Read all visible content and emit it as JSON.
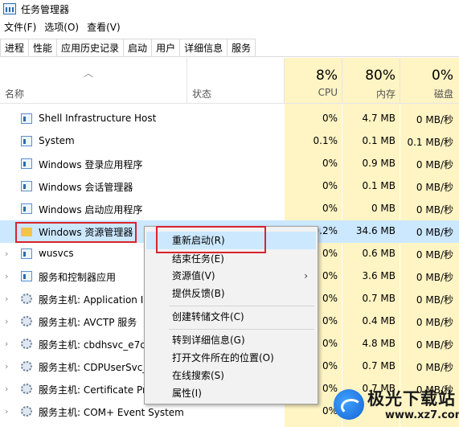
{
  "window": {
    "title": "任务管理器"
  },
  "menu": [
    "文件(F)",
    "选项(O)",
    "查看(V)"
  ],
  "tabs": [
    "进程",
    "性能",
    "应用历史记录",
    "启动",
    "用户",
    "详细信息",
    "服务"
  ],
  "header": {
    "name": "名称",
    "status": "状态",
    "cpu_pct": "8%",
    "cpu": "CPU",
    "mem_pct": "80%",
    "mem": "内存",
    "disk_pct": "0%",
    "disk": "磁盘"
  },
  "rows": [
    {
      "name": "Shell Infrastructure Host",
      "cpu": "0%",
      "mem": "4.7 MB",
      "disk": "0 MB/秒"
    },
    {
      "name": "System",
      "cpu": "0.1%",
      "mem": "0.1 MB",
      "disk": "0.1 MB/秒"
    },
    {
      "name": "Windows 登录应用程序",
      "cpu": "0%",
      "mem": "0.9 MB",
      "disk": "0 MB/秒"
    },
    {
      "name": "Windows 会话管理器",
      "cpu": "0%",
      "mem": "0.1 MB",
      "disk": "0 MB/秒"
    },
    {
      "name": "Windows 启动应用程序",
      "cpu": "0%",
      "mem": "0 MB",
      "disk": "0 MB/秒"
    },
    {
      "name": "Windows 资源管理器",
      "cpu": "0.2%",
      "mem": "34.6 MB",
      "disk": "0 MB/秒"
    },
    {
      "name": "wusvcs",
      "cpu": "0%",
      "mem": "0.6 MB",
      "disk": "0 MB/秒"
    },
    {
      "name": "服务和控制器应用",
      "cpu": "0%",
      "mem": "3.6 MB",
      "disk": "0 MB/秒"
    },
    {
      "name": "服务主机: Application In",
      "cpu": "0%",
      "mem": "0.7 MB",
      "disk": "0 MB/秒"
    },
    {
      "name": "服务主机: AVCTP 服务",
      "cpu": "0%",
      "mem": "0.4 MB",
      "disk": "0 MB/秒"
    },
    {
      "name": "服务主机: cbdhsvc_e7c3",
      "cpu": "0%",
      "mem": "4.8 MB",
      "disk": "0 MB/秒"
    },
    {
      "name": "服务主机: CDPUserSvc_",
      "cpu": "0%",
      "mem": "0.7 MB",
      "disk": "0 MB/秒"
    },
    {
      "name": "服务主机: Certificate Pr",
      "cpu": "0%",
      "mem": "0.7 MB",
      "disk": "0 MB/秒"
    },
    {
      "name": "服务主机: COM+ Event System",
      "cpu": "0%",
      "mem": "",
      "disk": ""
    }
  ],
  "context_menu": {
    "restart": "重新启动(R)",
    "end_task": "结束任务(E)",
    "resource_values": "资源值(V)",
    "feedback": "提供反馈(B)",
    "dump": "创建转储文件(C)",
    "details": "转到详细信息(G)",
    "open_location": "打开文件所在的位置(O)",
    "search_online": "在线搜索(S)",
    "properties": "属性(I)"
  },
  "watermark": {
    "name": "极光下载站",
    "url": "www.xz7.com"
  }
}
